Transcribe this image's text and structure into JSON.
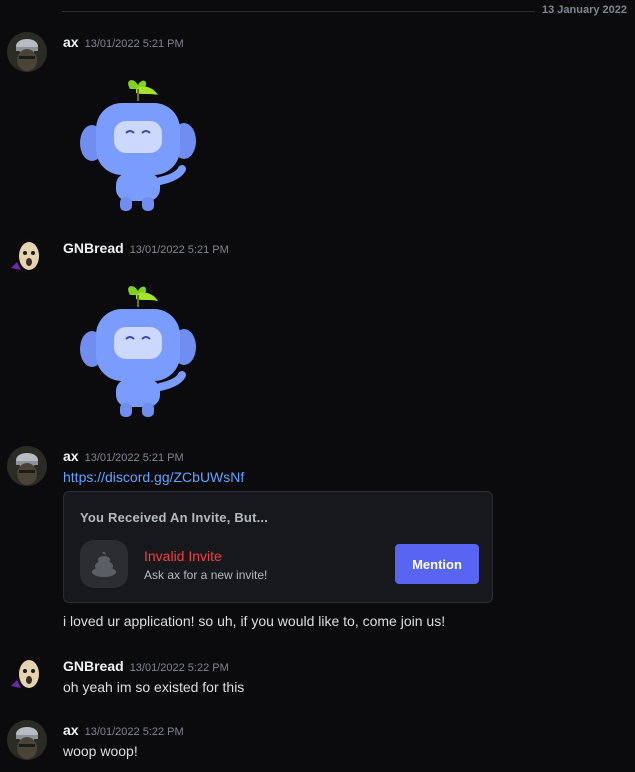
{
  "date_divider": "13 January 2022",
  "messages": [
    {
      "username": "ax",
      "timestamp": "13/01/2022 5:21 PM"
    },
    {
      "username": "GNBread",
      "timestamp": "13/01/2022 5:21 PM"
    },
    {
      "username": "ax",
      "timestamp": "13/01/2022 5:21 PM",
      "link": "https://discord.gg/ZCbUWsNf",
      "invite": {
        "heading": "You Received An Invite, But...",
        "status": "Invalid Invite",
        "subtext": "Ask ax for a new invite!",
        "button": "Mention"
      },
      "text": "i loved ur application! so uh, if you would like to, come join us!"
    },
    {
      "username": "GNBread",
      "timestamp": "13/01/2022 5:22 PM",
      "text": "oh yeah im so existed for this"
    },
    {
      "username": "ax",
      "timestamp": "13/01/2022 5:22 PM",
      "text": "woop woop!"
    }
  ],
  "icons": {
    "sticker": "wumpus-sticker-icon",
    "invite": "invite-guild-icon"
  },
  "colors": {
    "accent": "#5865f2",
    "error": "#f23f43",
    "link": "#5fa4ff"
  }
}
